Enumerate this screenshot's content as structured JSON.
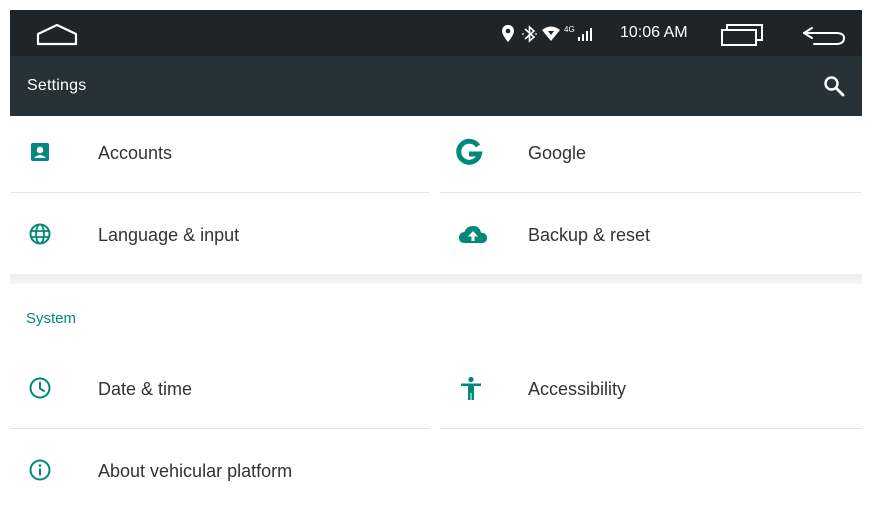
{
  "status_bar": {
    "time": "10:06 AM",
    "network_label": "4G",
    "icons": [
      "home-icon",
      "location-icon",
      "bluetooth-icon",
      "wifi-icon",
      "signal-icon",
      "recents-icon",
      "back-icon"
    ]
  },
  "app_bar": {
    "title": "Settings",
    "search_icon": "search-icon"
  },
  "sections": {
    "personal": {
      "items": [
        {
          "label": "Accounts",
          "icon": "account-icon"
        },
        {
          "label": "Google",
          "icon": "google-icon"
        },
        {
          "label": "Language & input",
          "icon": "globe-icon"
        },
        {
          "label": "Backup & reset",
          "icon": "cloud-upload-icon"
        }
      ]
    },
    "system": {
      "title": "System",
      "items": [
        {
          "label": "Date & time",
          "icon": "clock-icon"
        },
        {
          "label": "Accessibility",
          "icon": "accessibility-icon"
        },
        {
          "label": "About vehicular platform",
          "icon": "info-icon"
        }
      ]
    }
  },
  "colors": {
    "accent": "#00897b",
    "status_bar": "#1e2427",
    "app_bar": "#263238",
    "text": "#333333"
  }
}
